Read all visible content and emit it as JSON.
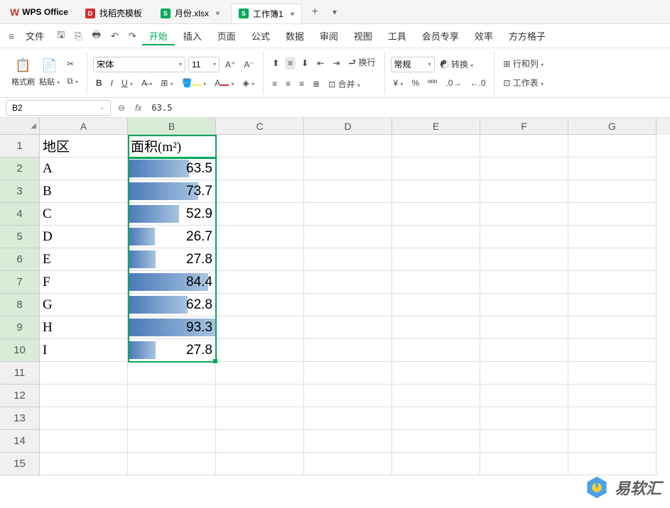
{
  "app": {
    "name": "WPS Office"
  },
  "tabs": [
    {
      "label": "找稻壳模板",
      "iconColor": "#d32f2f",
      "iconText": "D"
    },
    {
      "label": "月份.xlsx",
      "iconColor": "#06a85a",
      "iconText": "S"
    },
    {
      "label": "工作簿1",
      "iconColor": "#06a85a",
      "iconText": "S",
      "active": true
    }
  ],
  "menu": {
    "fileLabel": "文件",
    "items": [
      "开始",
      "插入",
      "页面",
      "公式",
      "数据",
      "审阅",
      "视图",
      "工具",
      "会员专享",
      "效率",
      "方方格子"
    ],
    "activeIndex": 0
  },
  "ribbon": {
    "formatPainter": "格式刷",
    "paste": "粘贴",
    "fontName": "宋体",
    "fontSize": "11",
    "numberFormat": "常规",
    "wrap": "换行",
    "merge": "合并",
    "convert": "转换",
    "rowsCols": "行和列",
    "worksheet": "工作表"
  },
  "formula": {
    "nameBox": "B2",
    "value": "63.5"
  },
  "columns": [
    "A",
    "B",
    "C",
    "D",
    "E",
    "F",
    "G"
  ],
  "rows": [
    "1",
    "2",
    "3",
    "4",
    "5",
    "6",
    "7",
    "8",
    "9",
    "10",
    "11",
    "12",
    "13",
    "14",
    "15"
  ],
  "data": {
    "headerA": "地区",
    "headerB": "面积(m²)",
    "regions": [
      "A",
      "B",
      "C",
      "D",
      "E",
      "F",
      "G",
      "H",
      "I"
    ],
    "values": [
      "63.5",
      "73.7",
      "52.9",
      "26.7",
      "27.8",
      "84.4",
      "62.8",
      "93.3",
      "27.8"
    ],
    "barWidths": [
      68,
      79,
      57,
      29,
      30,
      90,
      67,
      100,
      30
    ]
  },
  "watermark": "易软汇",
  "chart_data": {
    "type": "bar",
    "title": "面积(m²)",
    "categories": [
      "A",
      "B",
      "C",
      "D",
      "E",
      "F",
      "G",
      "H",
      "I"
    ],
    "values": [
      63.5,
      73.7,
      52.9,
      26.7,
      27.8,
      84.4,
      62.8,
      93.3,
      27.8
    ],
    "xlabel": "地区",
    "ylabel": "面积(m²)"
  }
}
